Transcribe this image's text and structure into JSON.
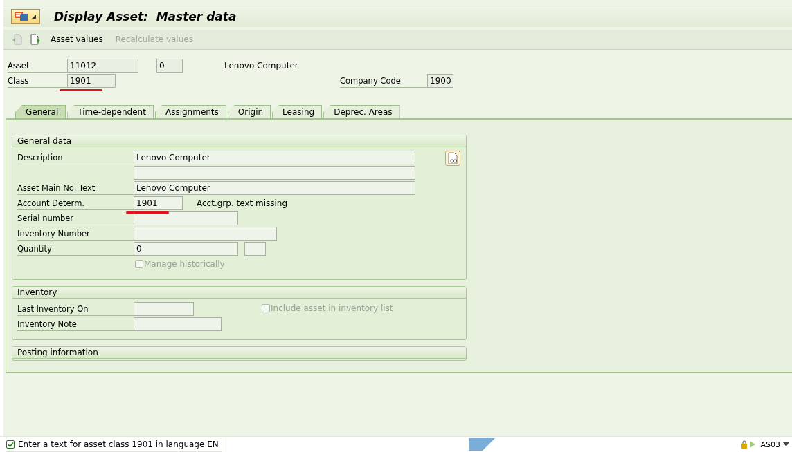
{
  "window": {
    "title": "Display Asset:  Master data"
  },
  "toolbar": [
    {
      "label": "Asset values",
      "disabled": false
    },
    {
      "label": "Recalculate values",
      "disabled": true
    }
  ],
  "header": {
    "asset": {
      "label": "Asset",
      "value": "11012",
      "sub_number": "0",
      "description": "Lenovo Computer"
    },
    "class": {
      "label": "Class",
      "value": "1901",
      "annotated": true
    },
    "company_code": {
      "label": "Company Code",
      "value": "1900"
    }
  },
  "tabs": [
    {
      "label": "General",
      "selected": true
    },
    {
      "label": "Time-dependent",
      "selected": false
    },
    {
      "label": "Assignments",
      "selected": false
    },
    {
      "label": "Origin",
      "selected": false
    },
    {
      "label": "Leasing",
      "selected": false
    },
    {
      "label": "Deprec. Areas",
      "selected": false
    }
  ],
  "groups": [
    {
      "title": "General data",
      "rows": [
        {
          "kind": "field",
          "label": "Description",
          "value": "Lenovo Computer"
        },
        {
          "kind": "field"
        },
        {
          "kind": "field",
          "label": "Asset Main No. Text",
          "value": "Lenovo Computer"
        },
        {
          "kind": "field",
          "label": "Account Determ.",
          "value": "1901",
          "note": "Acct.grp. text missing",
          "annotated": true
        },
        {
          "kind": "field",
          "label": "Serial number"
        },
        {
          "kind": "field",
          "label": "Inventory Number"
        },
        {
          "kind": "unit",
          "label": "Quantity",
          "value": "0"
        },
        {
          "kind": "checkbox",
          "label": "Manage historically",
          "checked": false,
          "disabled": true
        }
      ]
    },
    {
      "title": "Inventory",
      "rows": [
        {
          "kind": "field",
          "label": "Last Inventory On",
          "side_checkbox": {
            "label": "Include asset in inventory list",
            "checked": false,
            "disabled": true
          }
        },
        {
          "kind": "field",
          "label": "Inventory Note"
        }
      ]
    },
    {
      "title": "Posting information"
    }
  ],
  "status_bar": {
    "kind": "success",
    "message": "Enter a text for asset class 1901 in language EN",
    "transaction": "AS03"
  }
}
